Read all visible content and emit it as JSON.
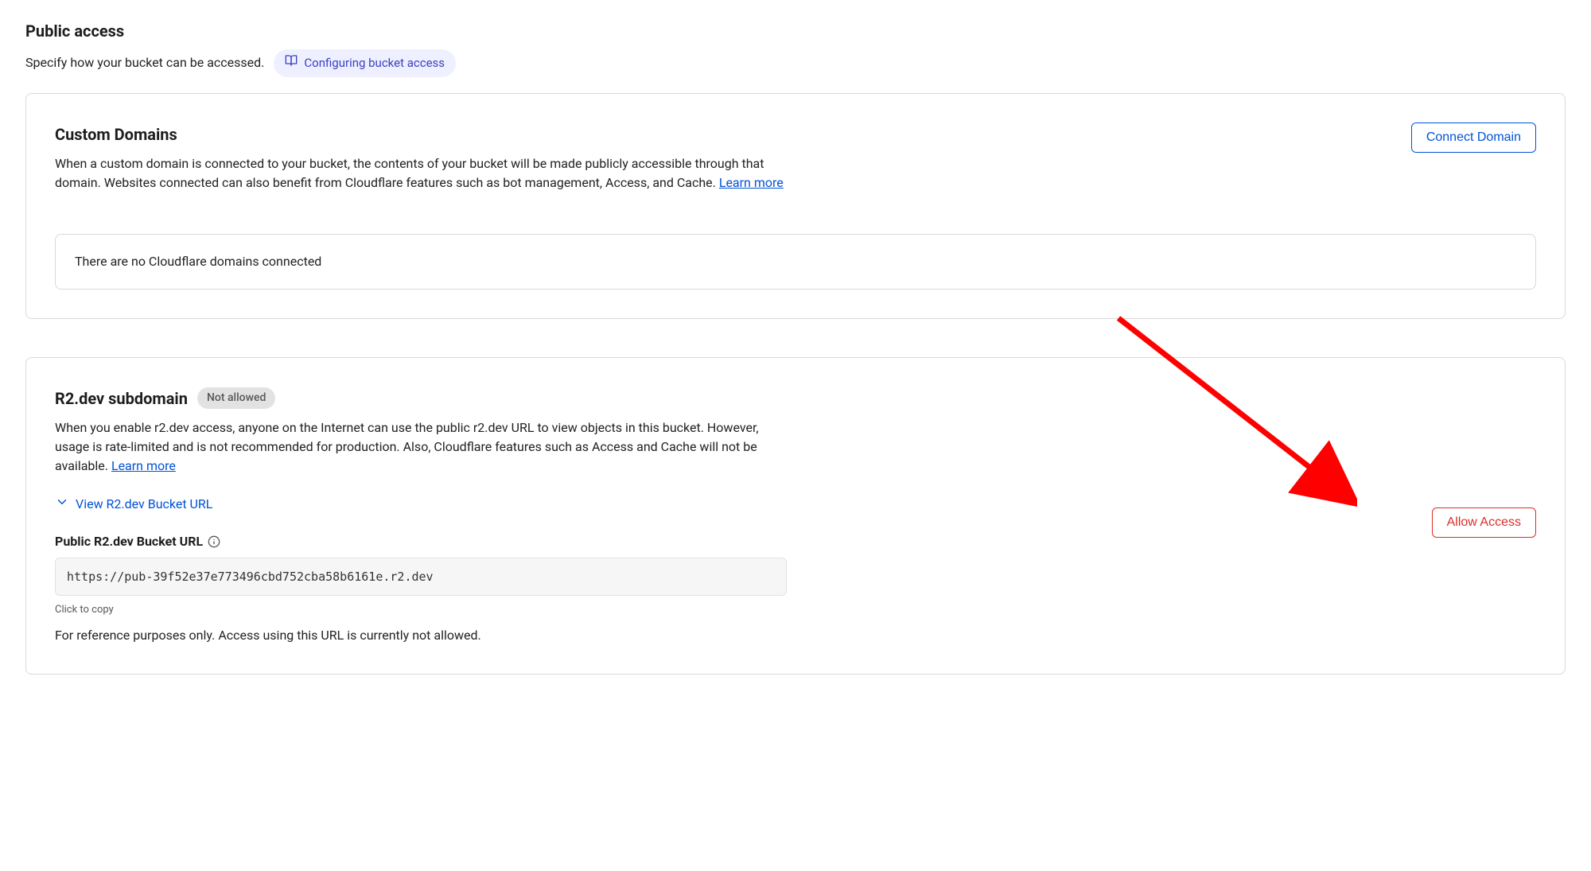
{
  "header": {
    "title": "Public access",
    "subtitle": "Specify how your bucket can be accessed.",
    "docsLinkLabel": "Configuring bucket access"
  },
  "customDomains": {
    "title": "Custom Domains",
    "description": "When a custom domain is connected to your bucket, the contents of your bucket will be made publicly accessible through that domain. Websites connected can also benefit from Cloudflare features such as bot management, Access, and Cache. ",
    "learnMore": "Learn more",
    "connectButton": "Connect Domain",
    "emptyMessage": "There are no Cloudflare domains connected"
  },
  "r2dev": {
    "title": "R2.dev subdomain",
    "badge": "Not allowed",
    "description": "When you enable r2.dev access, anyone on the Internet can use the public r2.dev URL to view objects in this bucket. However, usage is rate-limited and is not recommended for production. Also, Cloudflare features such as Access and Cache will not be available. ",
    "learnMore": "Learn more",
    "expandLabel": "View R2.dev Bucket URL",
    "urlLabel": "Public R2.dev Bucket URL",
    "url": "https://pub-39f52e37e773496cbd752cba58b6161e.r2.dev",
    "copyHint": "Click to copy",
    "refNote": "For reference purposes only. Access using this URL is currently not allowed.",
    "allowButton": "Allow Access"
  },
  "colors": {
    "linkBlue": "#0053d6",
    "dangerRed": "#d93025",
    "pillBg": "#eef0ff",
    "pillFg": "#3b41c5",
    "badgeBg": "#e2e2e2"
  }
}
